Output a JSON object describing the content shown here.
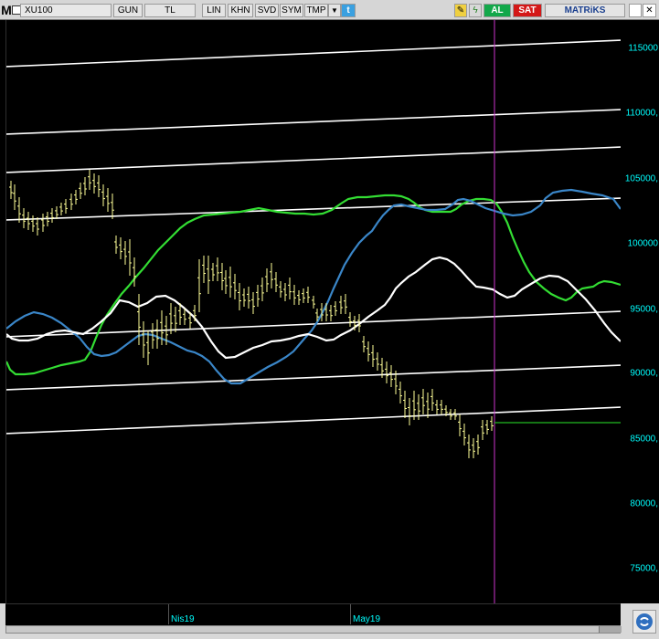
{
  "toolbar": {
    "menu_letter": "M",
    "symbol": "XU100",
    "buttons": [
      "GUN",
      "TL",
      "LIN",
      "KHN",
      "SVD",
      "SYM",
      "TMP"
    ],
    "buy_label": "AL",
    "sell_label": "SAT",
    "brand": "MATRiKS",
    "icons": [
      "dropdown-icon",
      "twitter-icon",
      "edit-icon",
      "lightning-icon",
      "window-icon"
    ]
  },
  "chart_data": {
    "type": "candlestick",
    "y_ticks": [
      "115000",
      "110000,",
      "105000,",
      "100000",
      "95000,",
      "90000,",
      "85000,",
      "80000,",
      "75000,"
    ],
    "x_ticks": [
      "Nis19",
      "May19"
    ],
    "colors": {
      "background": "#000000",
      "bars": "#ffff99",
      "trend_lines": "#ffffff",
      "fast_ma": "#ffffff",
      "mid_ma": "#3a86c8",
      "slow_ma": "#33dd33",
      "cursor_line": "#cc33cc",
      "price_marker": "#22bb22",
      "axis_text": "#00ffff"
    }
  }
}
